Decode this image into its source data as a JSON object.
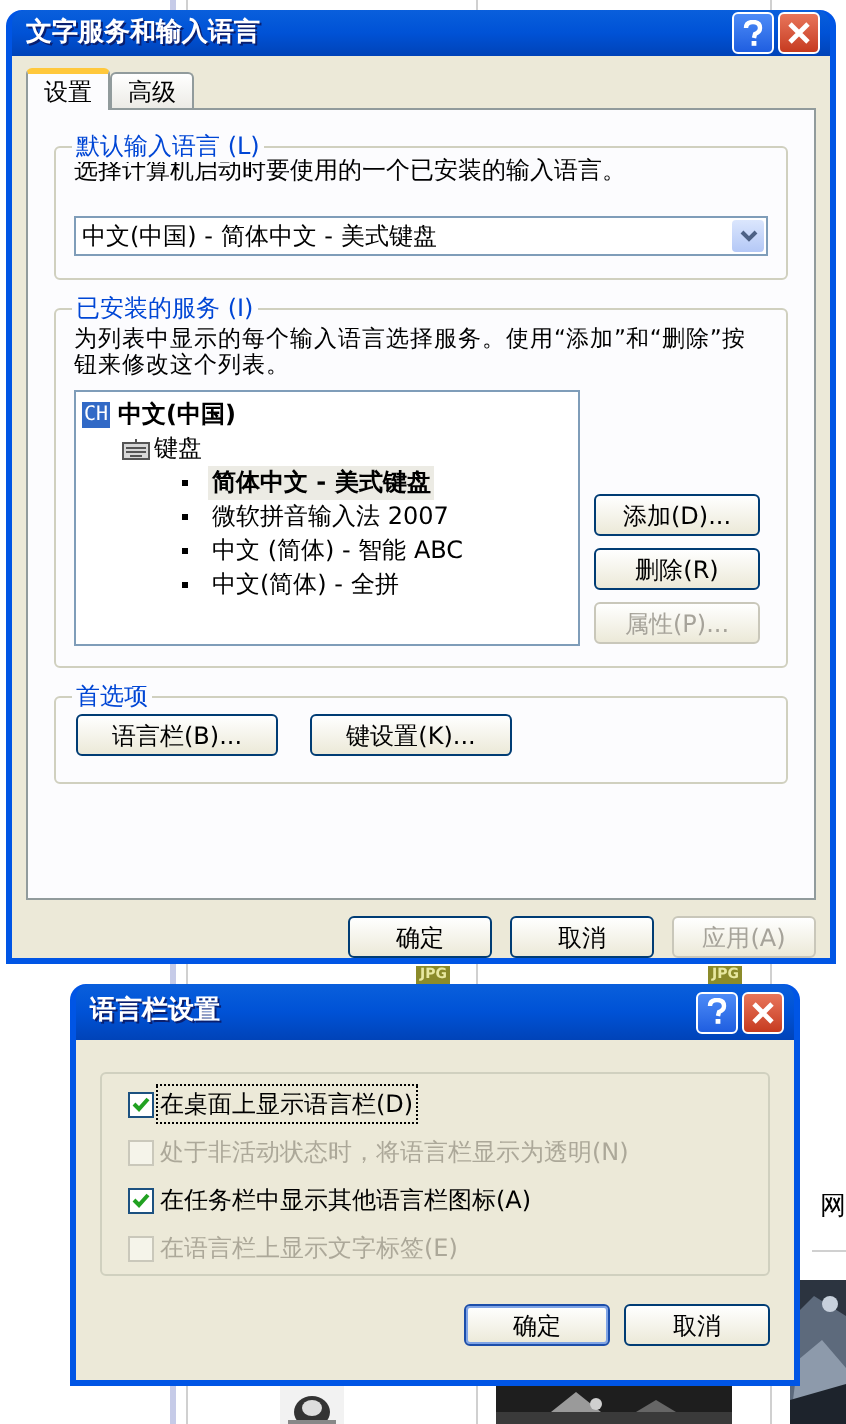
{
  "background": {
    "badges": [
      "JPG",
      "JPG"
    ],
    "side_text": "网"
  },
  "main_dialog": {
    "title": "文字服务和输入语言",
    "tabs": [
      {
        "label": "设置",
        "selected": true
      },
      {
        "label": "高级",
        "selected": false
      }
    ],
    "default_language": {
      "legend": "默认输入语言 (L)",
      "description": "选择计算机启动时要使用的一个已安装的输入语言。",
      "dropdown_value": "中文(中国) - 简体中文 - 美式键盘"
    },
    "installed_services": {
      "legend": "已安装的服务 (I)",
      "description": "为列表中显示的每个输入语言选择服务。使用“添加”和“删除”按钮来修改这个列表。",
      "tree": {
        "badge": "CH",
        "label": "中文(中国)",
        "children": [
          {
            "label": "键盘",
            "children": [
              {
                "label": "简体中文 - 美式键盘",
                "selected": true
              },
              {
                "label": "微软拼音输入法 2007",
                "selected": false
              },
              {
                "label": "中文 (简体) - 智能 ABC",
                "selected": false
              },
              {
                "label": "中文(简体) - 全拼",
                "selected": false
              }
            ]
          }
        ]
      },
      "buttons": [
        {
          "label": "添加(D)...",
          "disabled": false
        },
        {
          "label": "删除(R)",
          "disabled": false
        },
        {
          "label": "属性(P)...",
          "disabled": true
        }
      ]
    },
    "preferences": {
      "legend": "首选项",
      "buttons": [
        {
          "label": "语言栏(B)...",
          "disabled": false
        },
        {
          "label": "键设置(K)...",
          "disabled": false
        }
      ]
    },
    "buttons": [
      {
        "label": "确定",
        "disabled": false
      },
      {
        "label": "取消",
        "disabled": false
      },
      {
        "label": "应用(A)",
        "disabled": true
      }
    ]
  },
  "language_bar_dialog": {
    "title": "语言栏设置",
    "options": [
      {
        "label": "在桌面上显示语言栏(D)",
        "checked": true,
        "disabled": false,
        "focused": true
      },
      {
        "label": "处于非活动状态时，将语言栏显示为透明(N)",
        "checked": false,
        "disabled": true,
        "focused": false
      },
      {
        "label": "在任务栏中显示其他语言栏图标(A)",
        "checked": true,
        "disabled": false,
        "focused": false
      },
      {
        "label": "在语言栏上显示文字标签(E)",
        "checked": false,
        "disabled": true,
        "focused": false
      }
    ],
    "buttons": [
      {
        "label": "确定",
        "default": true
      },
      {
        "label": "取消",
        "default": false
      }
    ]
  }
}
